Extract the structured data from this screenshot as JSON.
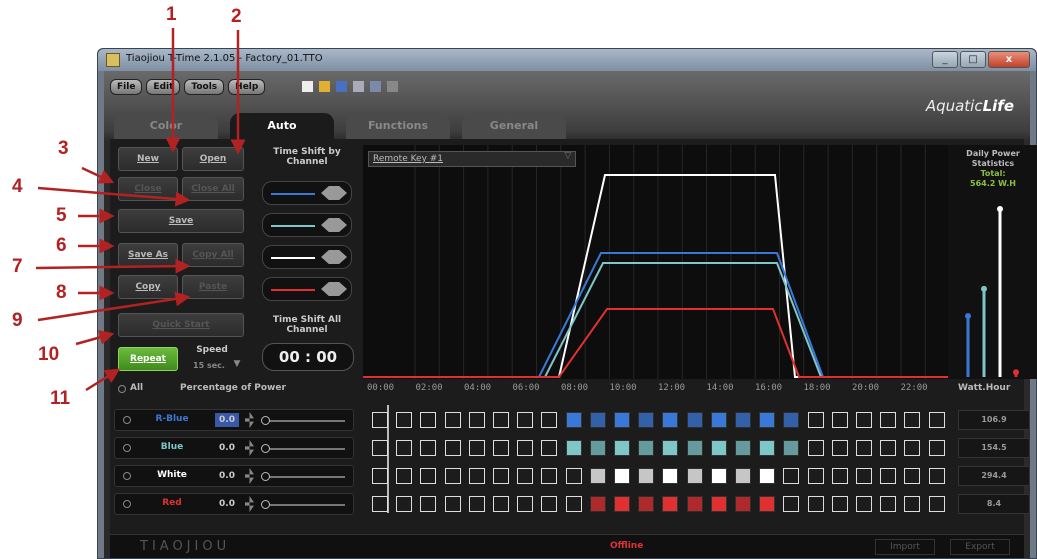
{
  "window": {
    "title": "Tiaojiou T-Time 2.1.05 - Factory_01.TTO",
    "controls": [
      "_",
      "□",
      "x"
    ]
  },
  "menu": [
    "File",
    "Edit",
    "Tools",
    "Help"
  ],
  "toolbar_icons": [
    "new-file-icon",
    "open-folder-icon",
    "save-icon",
    "brush-icon",
    "pencil-icon",
    "pen-icon"
  ],
  "brand": {
    "name_light": "Aquatic",
    "name_bold": "Life"
  },
  "tabs": [
    "Color",
    "Auto",
    "Functions",
    "General"
  ],
  "active_tab": "Auto",
  "buttons": {
    "new": "New",
    "open": "Open",
    "close": "Close",
    "close_all": "Close All",
    "save": "Save",
    "save_as": "Save As",
    "copy_all": "Copy All",
    "copy": "Copy",
    "paste": "Paste",
    "quick_start": "Quick Start",
    "repeat": "Repeat"
  },
  "speed": {
    "label": "Speed",
    "value": "15 sec."
  },
  "time_shift": {
    "by_channel_label": "Time Shift by Channel",
    "all_channel_label": "Time Shift All Channel",
    "all_value": "00 : 00"
  },
  "remote_key": "Remote Key #1",
  "daily_stats": {
    "title": "Daily Power Statistics",
    "total_label": "Total:",
    "total_value": "564.2 W.H"
  },
  "percentage_header": {
    "all": "All",
    "title": "Percentage of Power"
  },
  "axis_labels": [
    "00:00",
    "02:00",
    "04:00",
    "06:00",
    "08:00",
    "10:00",
    "12:00",
    "14:00",
    "16:00",
    "18:00",
    "20:00",
    "22:00"
  ],
  "watt_hour_label": "Watt.Hour",
  "channels": [
    {
      "name": "R-Blue",
      "value": "0.0",
      "color": "#3a78d8",
      "watt_hour": "106.9"
    },
    {
      "name": "Blue",
      "value": "0.0",
      "color": "#7fc6c8",
      "watt_hour": "154.5"
    },
    {
      "name": "White",
      "value": "0.0",
      "color": "#ffffff",
      "watt_hour": "294.4"
    },
    {
      "name": "Red",
      "value": "0.0",
      "color": "#e03030",
      "watt_hour": "8.4"
    }
  ],
  "status": {
    "logo": "TIAOJIOU",
    "connection": "Offline",
    "import": "Import",
    "export": "Export"
  },
  "annotations": [
    "1",
    "2",
    "3",
    "4",
    "5",
    "6",
    "7",
    "8",
    "9",
    "10",
    "11"
  ]
}
